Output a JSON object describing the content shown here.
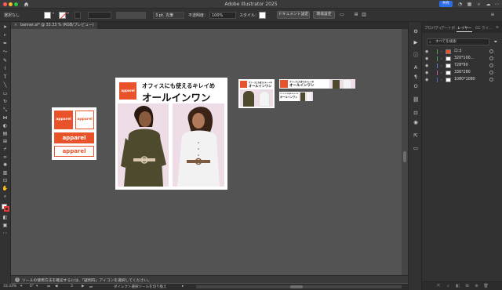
{
  "app": {
    "title": "Adobe Illustrator 2025",
    "share_label": "共有"
  },
  "control_bar": {
    "selection_label": "選択なし",
    "stroke_width": "3 pt. 丸筆",
    "opacity_label": "不透明度：",
    "opacity_value": "100%",
    "style_label": "スタイル：",
    "document_setup_label": "ドキュメント設定",
    "preferences_label": "環境設定"
  },
  "document_tab": {
    "label": "banner.ai* @ 33.33 % (RGB/プレビュー)",
    "close_glyph": "×"
  },
  "canvas": {
    "artboard_small": {
      "badge_text": "apparel",
      "wide_badge_text": "apparel"
    },
    "artboard_main": {
      "badge_text": "apparel",
      "headline_1": "オフィスにも使えるキレイめ",
      "headline_2": "オールインワン"
    },
    "artboard_banner_a": {
      "badge_text": "apparel",
      "headline_1": "オフィスにも使えるキレイめ",
      "headline_2": "オールインワン"
    },
    "artboard_banner_b": {
      "badge_text": "apparel",
      "headline_1": "オフィスにも使えるキレイめ",
      "headline_2": "オールインワン"
    },
    "artboard_banner_c": {
      "headline_1": "オフィスにも使えるキレイめ",
      "headline_2": "オールインワン"
    }
  },
  "hint": {
    "text": "ツールの使用方法を確認するには、「疑問符」アイコンを選択してください。"
  },
  "status_bar": {
    "zoom": "33.33%",
    "rotation": "0°",
    "artboard_number": "3",
    "tool_name": "ダイレクト選択ツールを切り換え"
  },
  "panel": {
    "tabs": [
      "プロパティ",
      "アートボ…",
      "レイヤー",
      "CC ライ…"
    ],
    "active_tab_index": 2,
    "search_placeholder": "すべてを検索",
    "layers": [
      {
        "name": "ロゴ",
        "color": "#4caf50"
      },
      {
        "name": "320*100...",
        "color": "#4caf50"
      },
      {
        "name": "728*90",
        "color": "#4c8bd6"
      },
      {
        "name": "336*280",
        "color": "#c65bc2"
      },
      {
        "name": "1080*1080",
        "color": "#4b6fd6"
      }
    ]
  },
  "colors": {
    "brand_orange": "#e8532b",
    "photo_bg": "#eedde6",
    "accent_blue": "#2b6ee8"
  }
}
